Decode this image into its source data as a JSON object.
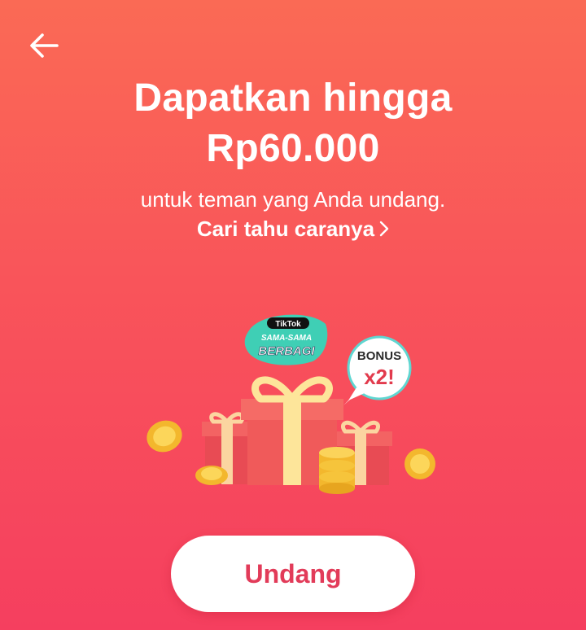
{
  "header": {
    "back_icon": "arrow-left-icon"
  },
  "hero": {
    "title_line1": "Dapatkan hingga",
    "title_line2": "Rp60.000",
    "subtitle": "untuk teman yang Anda undang.",
    "learn_more": "Cari tahu caranya"
  },
  "illustration": {
    "badge_brand": "TikTok",
    "badge_line1": "SAMA-SAMA",
    "badge_line2": "BERBAGI",
    "bonus_label": "BONUS",
    "bonus_multiplier": "x2!"
  },
  "cta": {
    "invite_label": "Undang"
  },
  "colors": {
    "background_top": "#fa6a55",
    "background_bottom": "#f53f5f",
    "button_text": "#e23b59",
    "gift_box": "#f05a5a",
    "ribbon": "#fde59a",
    "coin": "#f6c43b"
  }
}
